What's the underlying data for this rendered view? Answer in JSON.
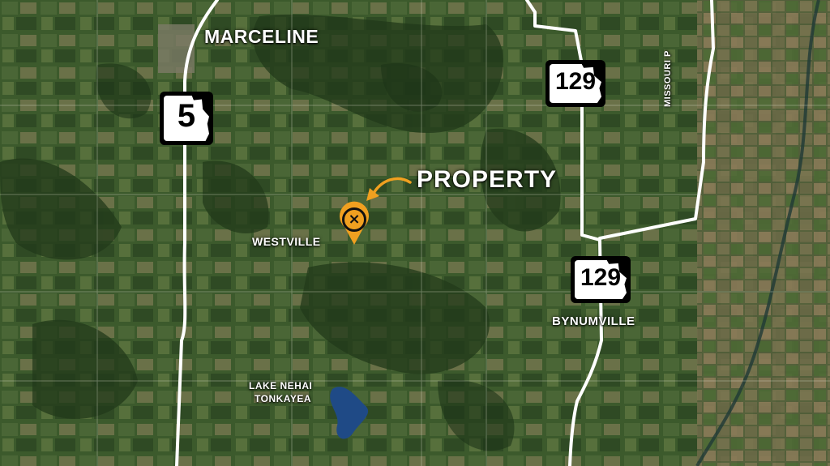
{
  "map": {
    "places": {
      "marceline": "MARCELINE",
      "westville": "WESTVILLE",
      "bynumville": "BYNUMVILLE",
      "lake_line1": "LAKE NEHAI",
      "lake_line2": "TONKAYEA"
    },
    "callout": "PROPERTY",
    "road_label": "MISSOURI P",
    "shields": {
      "route_5": "5",
      "route_129_north": "129",
      "route_129_south": "129"
    },
    "marker_symbol": "×",
    "colors": {
      "accent": "#f0a020",
      "road": "#ffffff",
      "terrain_dark": "#2b4220",
      "terrain_light": "#6d7548"
    },
    "icons": [
      "map-pin-icon",
      "curved-arrow-icon",
      "route-shield-icon"
    ]
  }
}
